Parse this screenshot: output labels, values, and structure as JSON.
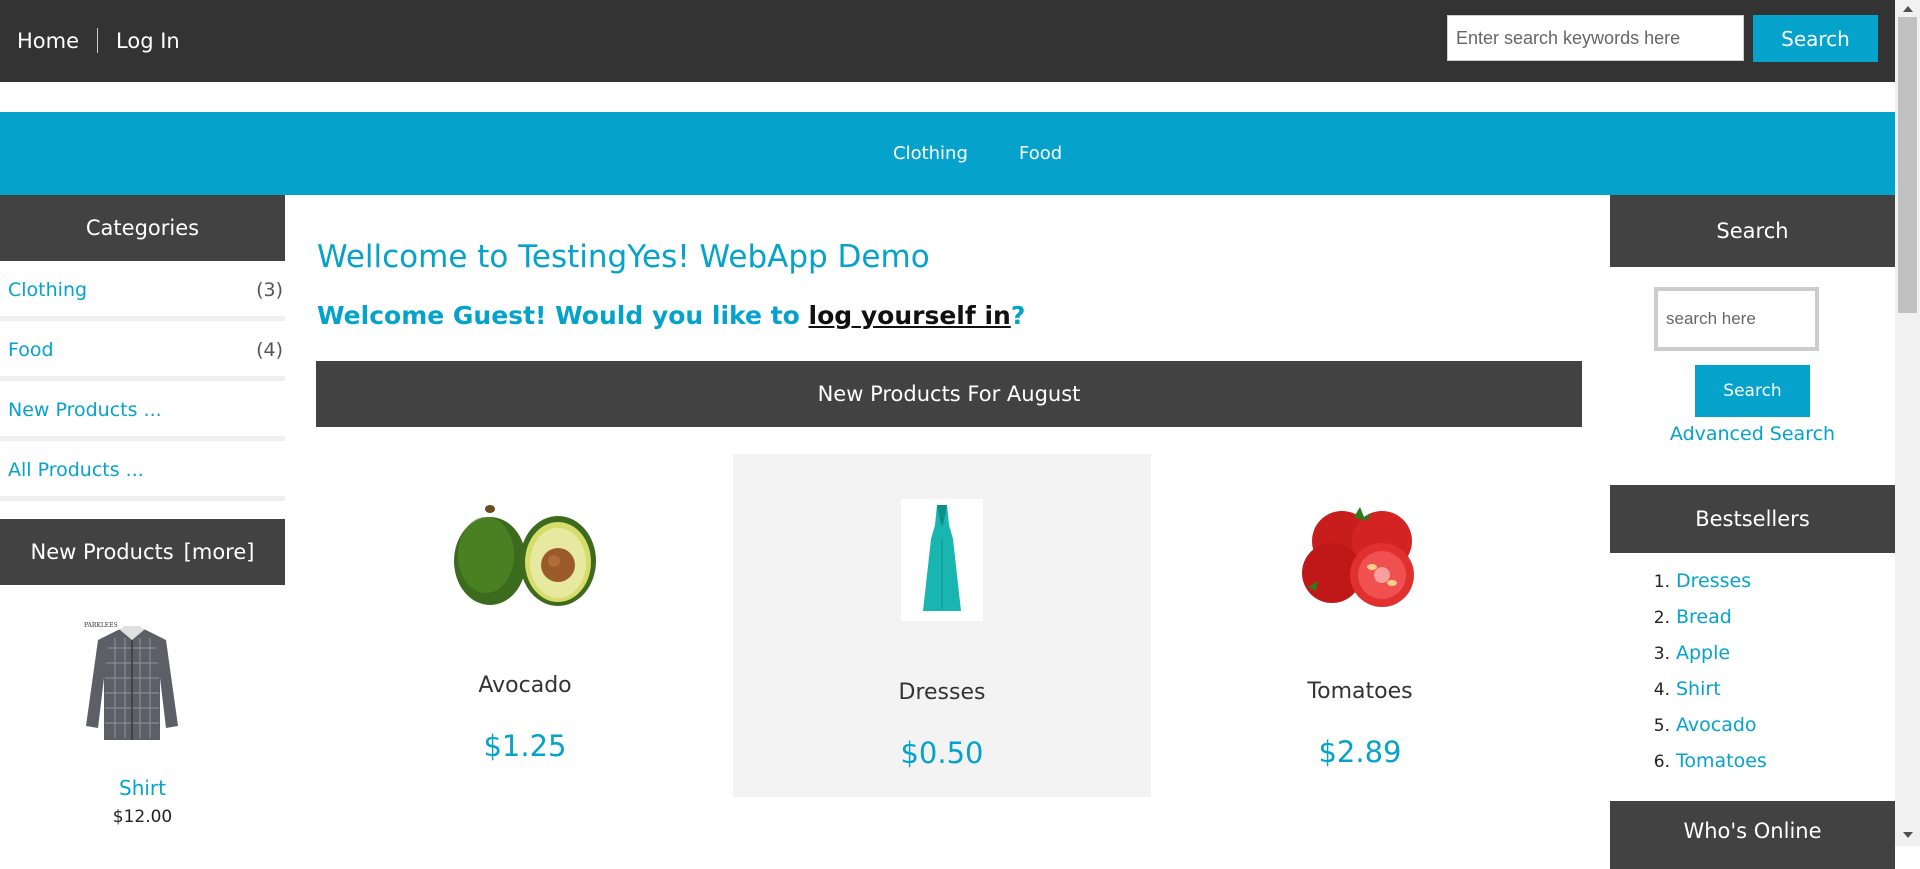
{
  "topbar": {
    "nav": [
      "Home",
      "Log In"
    ],
    "search_placeholder": "Enter search keywords here",
    "search_button": "Search"
  },
  "category_nav": [
    "Clothing",
    "Food"
  ],
  "sidebar_left": {
    "categories_title": "Categories",
    "categories": [
      {
        "label": "Clothing",
        "count": "(3)"
      },
      {
        "label": "Food",
        "count": "(4)"
      },
      {
        "label": "New Products ...",
        "count": ""
      },
      {
        "label": "All Products ...",
        "count": ""
      }
    ],
    "new_products_title": "New Products",
    "new_products_more": "[more]",
    "new_product": {
      "name": "Shirt",
      "price": "$12.00",
      "image_icon": "shirt-image",
      "brand_text": "PARKLEES"
    }
  },
  "main": {
    "welcome_title": "Wellcome to TestingYes! WebApp Demo",
    "welcome_prefix": "Welcome Guest! Would you like to ",
    "welcome_link": "log yourself in",
    "welcome_suffix": "?",
    "new_products_bar": "New Products For August",
    "products": [
      {
        "name": "Avocado",
        "price": "$1.25",
        "image_icon": "avocado-image"
      },
      {
        "name": "Dresses",
        "price": "$0.50",
        "image_icon": "dress-image"
      },
      {
        "name": "Tomatoes",
        "price": "$2.89",
        "image_icon": "tomato-image"
      }
    ]
  },
  "sidebar_right": {
    "search_title": "Search",
    "search_placeholder": "search here",
    "search_button": "Search",
    "advanced_search": "Advanced Search",
    "bestsellers_title": "Bestsellers",
    "bestsellers": [
      {
        "num": "1.",
        "label": "Dresses"
      },
      {
        "num": "2.",
        "label": "Bread"
      },
      {
        "num": "3.",
        "label": "Apple"
      },
      {
        "num": "4.",
        "label": "Shirt"
      },
      {
        "num": "5.",
        "label": "Avocado"
      },
      {
        "num": "6.",
        "label": "Tomatoes"
      }
    ],
    "whos_online_title": "Who's Online"
  },
  "colors": {
    "accent": "#05a3cc",
    "dark_bar": "#333333",
    "panel_head": "#424242",
    "highlight_card": "#f3f3f3"
  }
}
